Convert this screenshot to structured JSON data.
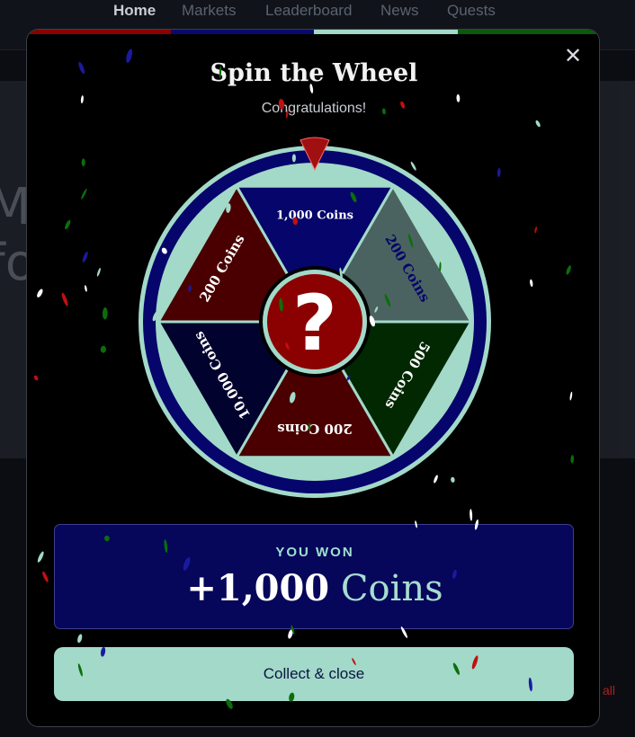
{
  "nav": {
    "items": [
      {
        "label": "Home",
        "active": true
      },
      {
        "label": "Markets",
        "active": false
      },
      {
        "label": "Leaderboard",
        "active": false
      },
      {
        "label": "News",
        "active": false
      },
      {
        "label": "Quests",
        "active": false
      }
    ]
  },
  "background": {
    "hero_text_line1": "M",
    "hero_text_line2": "fo",
    "side_link": "all"
  },
  "modal": {
    "title": "Spin the Wheel",
    "subtitle": "Congratulations!",
    "close_icon": "close-icon",
    "stripe_colors": [
      "#8b0000",
      "#0a0a6e",
      "#a3d9c9",
      "#0b5a0b"
    ]
  },
  "wheel": {
    "center_symbol": "?",
    "segments": [
      {
        "label": "1,000 Coins",
        "color": "#05056b"
      },
      {
        "label": "200 Coins",
        "color": "#4a6360"
      },
      {
        "label": "500 Coins",
        "color": "#012801"
      },
      {
        "label": "200 Coins",
        "color": "#4a0000"
      },
      {
        "label": "10,000 Coins",
        "color": "#02022e"
      },
      {
        "label": "200 Coins",
        "color": "#4a0000"
      }
    ],
    "rim_color": "#a3d9c9",
    "pointer_color": "#a01010"
  },
  "result": {
    "label": "YOU WON",
    "amount": "+1,000",
    "unit": "Coins"
  },
  "actions": {
    "collect_label": "Collect & close"
  }
}
